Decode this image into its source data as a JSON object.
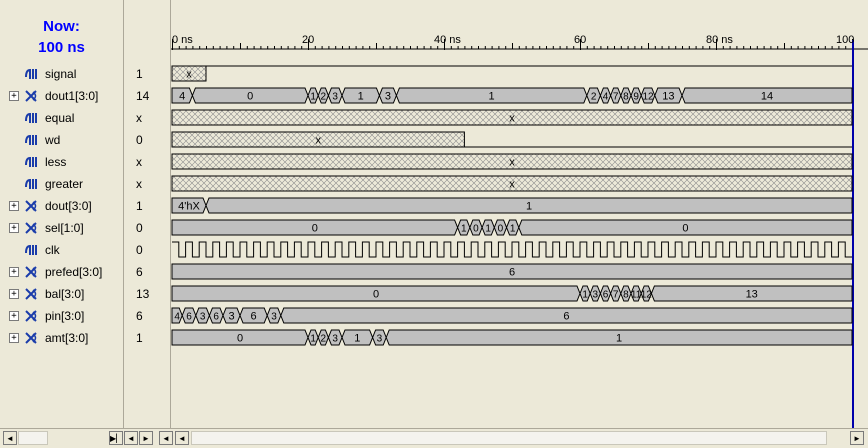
{
  "now": {
    "line1": "Now:",
    "line2": "100 ns"
  },
  "ruler": {
    "labels": [
      "0 ns",
      "20",
      "40 ns",
      "60",
      "80 ns",
      "100"
    ]
  },
  "signals": [
    {
      "name": "signal",
      "value": "1",
      "expandable": false,
      "icon": "bit-signal-icon",
      "kind": "hatch-until",
      "hatch_end_ns": 5,
      "label": "x"
    },
    {
      "name": "dout1[3:0]",
      "value": "14",
      "expandable": true,
      "icon": "bus-signal-icon",
      "kind": "bus",
      "segments": [
        [
          "4",
          0,
          3
        ],
        [
          "0",
          3,
          20
        ],
        [
          "1",
          20,
          21.5
        ],
        [
          "2",
          21.5,
          23
        ],
        [
          "3",
          23,
          25
        ],
        [
          "1",
          25,
          30.5
        ],
        [
          "3",
          30.5,
          33
        ],
        [
          "1",
          33,
          61
        ],
        [
          "2",
          61,
          63
        ],
        [
          "4",
          63,
          64.5
        ],
        [
          "7",
          64.5,
          66
        ],
        [
          "8",
          66,
          67.5
        ],
        [
          "9",
          67.5,
          69
        ],
        [
          "12",
          69,
          71
        ],
        [
          "13",
          71,
          75
        ],
        [
          "14",
          75,
          100
        ]
      ]
    },
    {
      "name": "equal",
      "value": "x",
      "expandable": false,
      "icon": "bit-signal-icon",
      "kind": "hatch",
      "label": "x"
    },
    {
      "name": "wd",
      "value": "0",
      "expandable": false,
      "icon": "bit-signal-icon",
      "kind": "hatch-then-low",
      "hatch_end_ns": 43,
      "label": "x"
    },
    {
      "name": "less",
      "value": "x",
      "expandable": false,
      "icon": "bit-signal-icon",
      "kind": "hatch",
      "label": "x"
    },
    {
      "name": "greater",
      "value": "x",
      "expandable": false,
      "icon": "bit-signal-icon",
      "kind": "hatch",
      "label": "x"
    },
    {
      "name": "dout[3:0]",
      "value": "1",
      "expandable": true,
      "icon": "bus-signal-icon",
      "kind": "bus",
      "segments": [
        [
          "4'hX",
          0,
          5
        ],
        [
          "1",
          5,
          100
        ]
      ]
    },
    {
      "name": "sel[1:0]",
      "value": "0",
      "expandable": true,
      "icon": "bus-signal-icon",
      "kind": "bus",
      "segments": [
        [
          "0",
          0,
          42
        ],
        [
          "1",
          42,
          43.8
        ],
        [
          "0",
          43.8,
          45.6
        ],
        [
          "1",
          45.6,
          47.4
        ],
        [
          "0",
          47.4,
          49.2
        ],
        [
          "1",
          49.2,
          51
        ],
        [
          "0",
          51,
          100
        ]
      ]
    },
    {
      "name": "clk",
      "value": "0",
      "expandable": false,
      "icon": "bit-signal-icon",
      "kind": "clock",
      "period_ns": 2
    },
    {
      "name": "prefed[3:0]",
      "value": "6",
      "expandable": true,
      "icon": "bus-signal-icon",
      "kind": "bus",
      "segments": [
        [
          "6",
          0,
          100
        ]
      ]
    },
    {
      "name": "bal[3:0]",
      "value": "13",
      "expandable": true,
      "icon": "bus-signal-icon",
      "kind": "bus",
      "segments": [
        [
          "0",
          0,
          60
        ],
        [
          "1",
          60,
          61.5
        ],
        [
          "3",
          61.5,
          63
        ],
        [
          "6",
          63,
          64.5
        ],
        [
          "7",
          64.5,
          66
        ],
        [
          "8",
          66,
          67.5
        ],
        [
          "11",
          67.5,
          69
        ],
        [
          "12",
          69,
          70.5
        ],
        [
          "13",
          70.5,
          100
        ]
      ]
    },
    {
      "name": "pin[3:0]",
      "value": "6",
      "expandable": true,
      "icon": "bus-signal-icon",
      "kind": "bus",
      "segments": [
        [
          "4",
          0,
          1.5
        ],
        [
          "6",
          1.5,
          3.5
        ],
        [
          "3",
          3.5,
          5.5
        ],
        [
          "6",
          5.5,
          7.5
        ],
        [
          "3",
          7.5,
          10
        ],
        [
          "6",
          10,
          14
        ],
        [
          "3",
          14,
          16
        ],
        [
          "6",
          16,
          100
        ]
      ]
    },
    {
      "name": "amt[3:0]",
      "value": "1",
      "expandable": true,
      "icon": "bus-signal-icon",
      "kind": "bus",
      "segments": [
        [
          "0",
          0,
          20
        ],
        [
          "1",
          20,
          21.5
        ],
        [
          "2",
          21.5,
          23
        ],
        [
          "3",
          23,
          25
        ],
        [
          "1",
          25,
          29.5
        ],
        [
          "3",
          29.5,
          31.5
        ],
        [
          "1",
          31.5,
          100
        ]
      ]
    }
  ]
}
